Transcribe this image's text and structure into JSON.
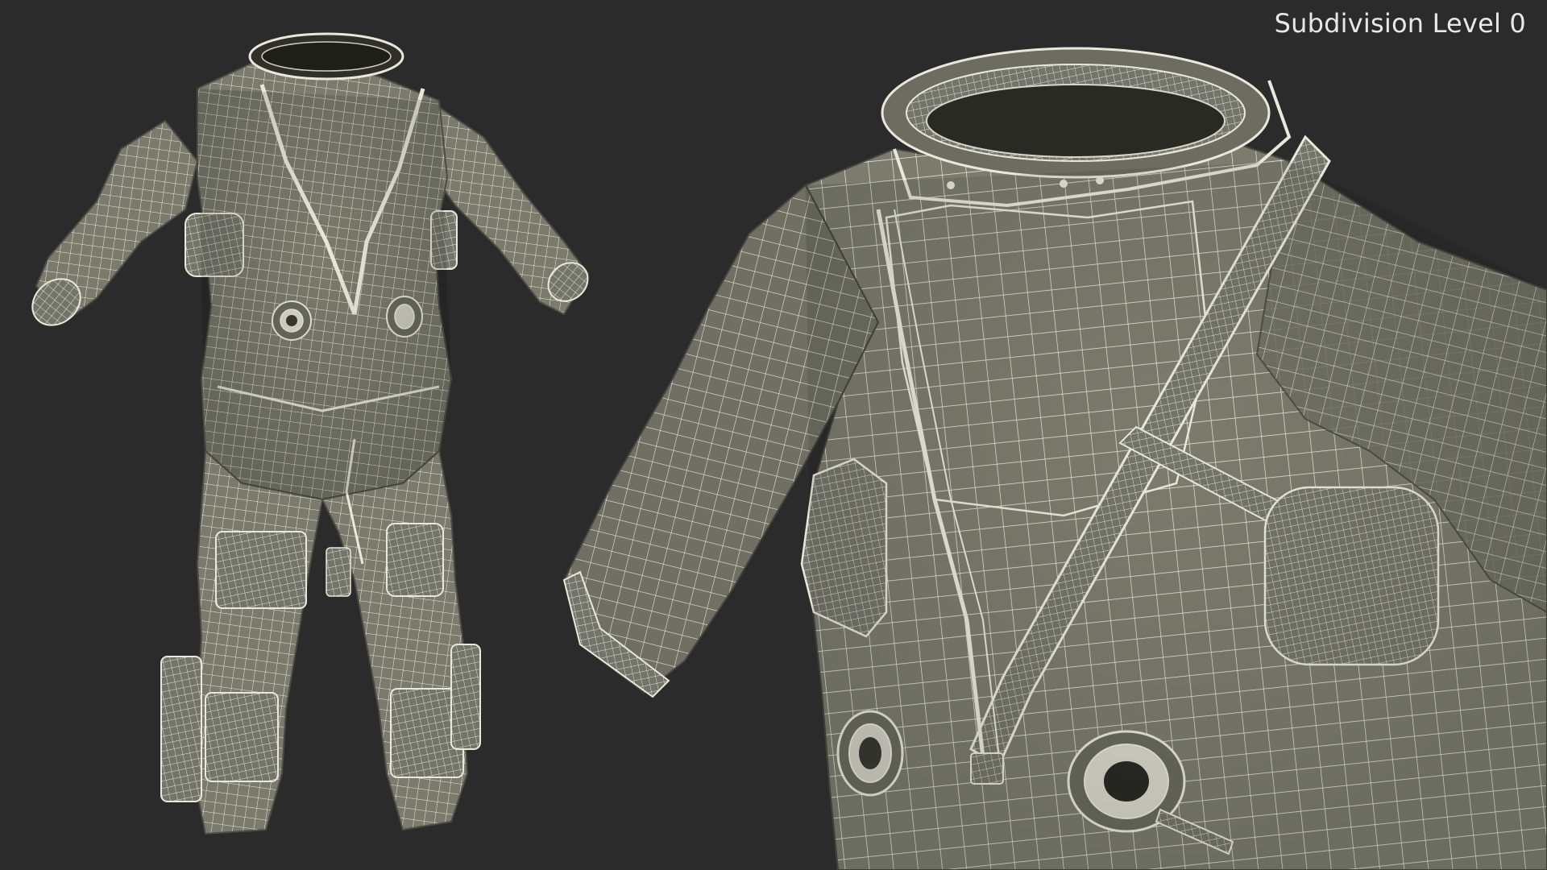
{
  "overlay": {
    "label": "Subdivision Level 0"
  },
  "colors": {
    "background": "#2b2b2b",
    "suit_fill": "#7a7b6d",
    "suit_shadow": "#5f6055",
    "wire": "#e9e8dc"
  },
  "views": {
    "full_body": "full-suit-wireframe",
    "close_up": "torso-closeup-wireframe"
  }
}
